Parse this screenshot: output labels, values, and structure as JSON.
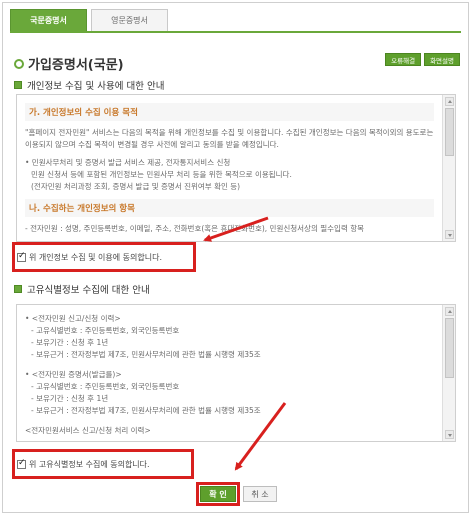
{
  "tabs": [
    {
      "label": "국문증명서",
      "active": true
    },
    {
      "label": "영문증명서",
      "active": false
    }
  ],
  "page": {
    "title": "가입증명서(국문)",
    "buttons": [
      "오류해결",
      "화면설명"
    ]
  },
  "section1": {
    "heading": "개인정보 수집 및 사용에 대한 안내",
    "sub_a": "가. 개인정보의 수집 이용 목적",
    "para_a": "\"홈페이지 전자민원\" 서비스는 다음의 목적을 위해 개인정보를 수집 및 이용합니다. 수집된 개인정보는 다음의 목적이외의 용도로는 이용되지 않으며 수집 목적이 변경될 경우 사전에 알리고 동의를 받을 예정입니다.",
    "para_b1": "• 민원사무처리 및 증명서 발급 서비스 제공, 전자통지서비스 신청",
    "para_b2": "민원 신청서 등에 포함된 개인정보는 민원사무 처리 등을 위한 목적으로 이용됩니다.",
    "para_b3": "(전자민원 처리과정 조회, 증명서 발급 및 증명서 진위여부 확인 등)",
    "sub_b": "나. 수집하는 개인정보의 항목",
    "faded_line": "- 전자민원 : 성명, 주민등록번호, 이메일, 주소, 전화번호(혹은 휴대전화번호), 민원신청서상의 필수입력 항목",
    "agree_label": "위 개인정보 수집 및 이용에 동의합니다.",
    "agree_checked": true
  },
  "section2": {
    "heading": "고유식별정보 수집에 대한 안내",
    "lines_a": [
      "• <전자민원 신고/신청 이력>",
      "- 고유식별번호 : 주민등록번호, 외국인등록번호",
      "- 보유기간 : 신청 후 1년",
      "- 보유근거 : 전자정부법 제7조, 민원사무처리에 관한 법률 시행령 제35조"
    ],
    "lines_b": [
      "• <전자민원 증명서(발급를)>",
      "- 고유식별번호 : 주민등록번호, 외국인등록번호",
      "- 보유기간 : 신청 후 1년",
      "- 보유근거 : 전자정부법 제7조, 민원사무처리에 관한 법률 시행령 제35조"
    ],
    "faded_line": "<전자민원서비스 신고/신청 처리 이력>",
    "agree_label": "위 고유식별정보 수집에 동의합니다.",
    "agree_checked": true
  },
  "actions": {
    "confirm": "확 인",
    "cancel": "취 소"
  },
  "colors": {
    "accent_green": "#6aa83a",
    "highlight_red": "#d8201e",
    "subheading_orange": "#c8782a"
  }
}
